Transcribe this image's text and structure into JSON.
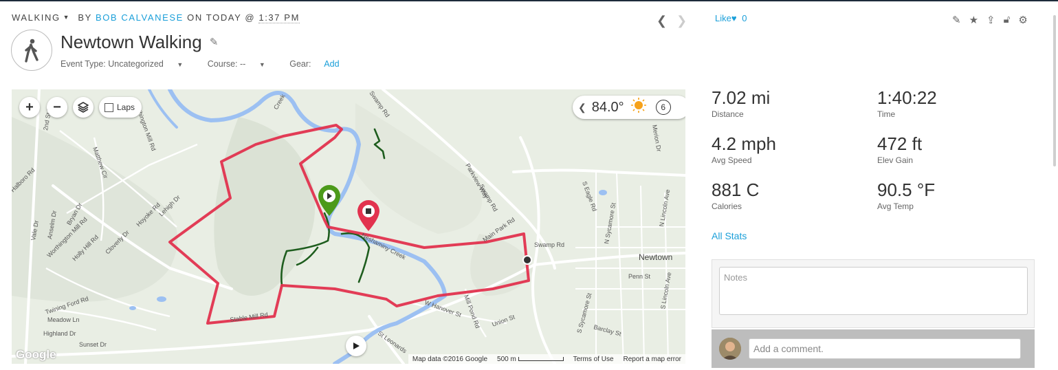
{
  "header": {
    "type_label": "WALKING",
    "by_label": "BY",
    "author": "BOB CALVANESE",
    "on_label": "ON TODAY @",
    "time": "1:37 PM",
    "title": "Newtown Walking",
    "event_type_label": "Event Type: Uncategorized",
    "course_label": "Course: --",
    "gear_label": "Gear:",
    "gear_add": "Add",
    "like_label": "Like",
    "like_count": "0"
  },
  "map": {
    "zoom_in": "+",
    "zoom_out": "−",
    "laps_label": "Laps",
    "temperature": "84.0°",
    "weather_count": "6",
    "google_logo": "Google",
    "footer": {
      "map_data": "Map data ©2016 Google",
      "scale": "500 m",
      "terms": "Terms of Use",
      "report": "Report a map error"
    },
    "labels": {
      "newtown": "Newtown",
      "swamp_rd": "Swamp Rd",
      "neshaminy_creek": "Neshaminy Creek",
      "creek": "Creek",
      "main_park_rd": "Main Park Rd",
      "parkview_way": "Parkview Way",
      "swamp_rd2": "Swamp Rd",
      "mill_pond_rd": "Mill Pond Rd",
      "w_hanover_st": "W Hanover St",
      "union_st": "Union St",
      "stable_mill_rd": "Stable Mill Rd",
      "twining_ford_rd": "Twining Ford Rd",
      "meadow_ln": "Meadow Ln",
      "highland_dr": "Highland Dr",
      "sunset_dr": "Sunset Dr",
      "northington_mill_rd": "Northington Mill Rd",
      "worthington_mill_rd": "Worthington Mill Rd",
      "holly_hill_rd": "Holly Hill Rd",
      "cloverly_dr": "Cloverly Dr",
      "hoyoke_rd": "Hoyoke Rd",
      "lehigh_dr": "Lehigh Dr",
      "bryan_dr": "Bryan Dr",
      "matthew_cir": "Matthew Cir",
      "anselm_dr": "Anselm Dr",
      "vale_dr": "Vale Dr",
      "halboro_rd": "Halboro Rd",
      "second_st_pk": "2nd St Pk",
      "s_eagle_rd": "S Eagle Rd",
      "n_sycamore_st": "N Sycamore St",
      "s_sycamore_st": "S Sycamore St",
      "n_lincoln_ave": "N Lincoln Ave",
      "s_lincoln_ave": "S Lincoln Ave",
      "penn_st": "Penn St",
      "barclay_st": "Barclay St",
      "merion_dr": "Merion Dr",
      "st_leonards": "St Leonards",
      "swamp_rd_top": "Swamp Rd"
    }
  },
  "stats": [
    {
      "value": "7.02 mi",
      "label": "Distance"
    },
    {
      "value": "1:40:22",
      "label": "Time"
    },
    {
      "value": "4.2 mph",
      "label": "Avg Speed"
    },
    {
      "value": "472 ft",
      "label": "Elev Gain"
    },
    {
      "value": "881 C",
      "label": "Calories"
    },
    {
      "value": "90.5 °F",
      "label": "Avg Temp"
    }
  ],
  "all_stats_link": "All Stats",
  "notes_placeholder": "Notes",
  "comment_placeholder": "Add a comment.",
  "colors": {
    "accent": "#1a9fd9",
    "route": "#e2324e",
    "trail": "#1e5d1e",
    "water": "#9cc0f2",
    "start_pin": "#4c9a1a",
    "end_pin": "#e2324e"
  }
}
